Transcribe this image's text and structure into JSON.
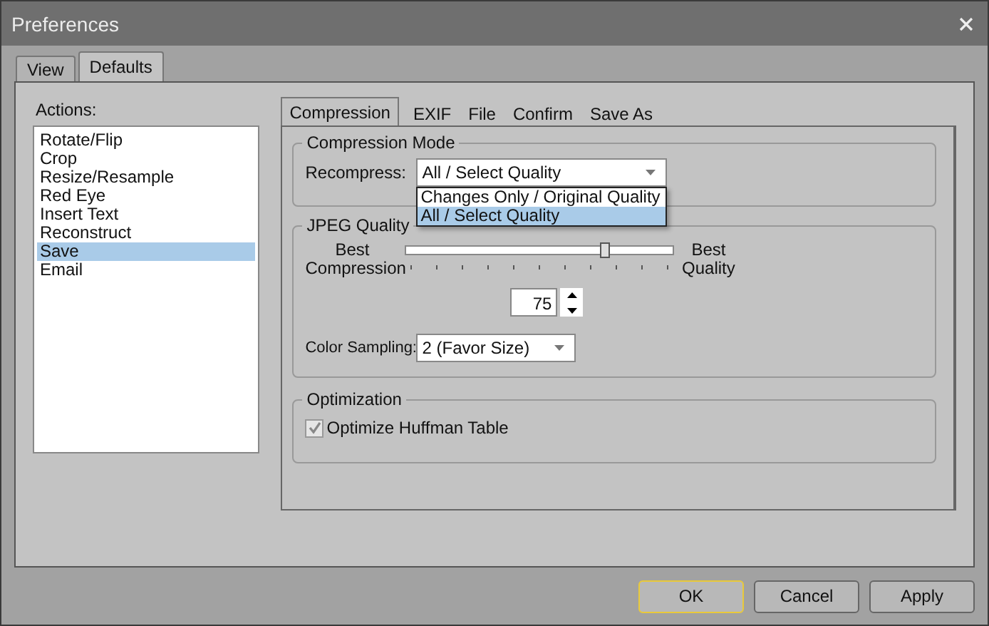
{
  "window": {
    "title": "Preferences"
  },
  "tabs": [
    {
      "label": "View",
      "selected": false
    },
    {
      "label": "Defaults",
      "selected": true
    }
  ],
  "actions": {
    "label": "Actions:",
    "items": [
      {
        "label": "Rotate/Flip",
        "selected": false
      },
      {
        "label": "Crop",
        "selected": false
      },
      {
        "label": "Resize/Resample",
        "selected": false
      },
      {
        "label": "Red Eye",
        "selected": false
      },
      {
        "label": "Insert Text",
        "selected": false
      },
      {
        "label": "Reconstruct",
        "selected": false
      },
      {
        "label": "Save",
        "selected": true
      },
      {
        "label": "Email",
        "selected": false
      }
    ]
  },
  "subtabs": [
    {
      "label": "Compression",
      "selected": true
    },
    {
      "label": "EXIF",
      "selected": false
    },
    {
      "label": "File",
      "selected": false
    },
    {
      "label": "Confirm",
      "selected": false
    },
    {
      "label": "Save As",
      "selected": false
    }
  ],
  "compression_mode": {
    "title": "Compression Mode",
    "label": "Recompress:",
    "value": "All / Select Quality",
    "expanded": true,
    "options": [
      {
        "label": "Changes Only / Original Quality",
        "selected": false
      },
      {
        "label": "All / Select Quality",
        "selected": true
      }
    ]
  },
  "jpeg_quality": {
    "title": "JPEG Quality",
    "min_label": "Best Compression",
    "max_label": "Best Quality",
    "level": 0.74,
    "value": "75",
    "sampling_label": "Color Sampling:",
    "sampling_value": "2 (Favor Size)"
  },
  "optimization": {
    "title": "Optimization",
    "checkbox": {
      "label": "Optimize Huffman Table",
      "checked": true
    }
  },
  "buttons": [
    {
      "label": "OK",
      "default": true
    },
    {
      "label": "Cancel",
      "default": false
    },
    {
      "label": "Apply",
      "default": false
    }
  ]
}
